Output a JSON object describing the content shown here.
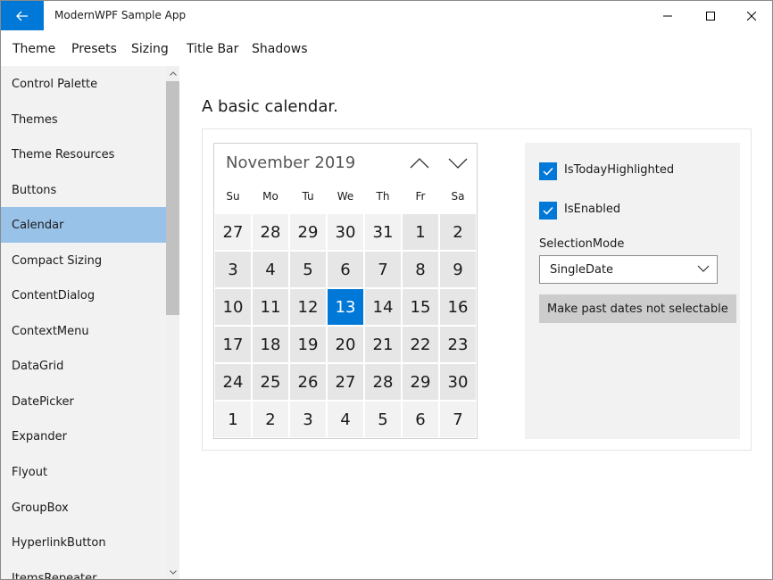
{
  "window": {
    "title": "ModernWPF Sample App"
  },
  "menu": [
    "Theme",
    "Presets",
    "Sizing",
    "Title Bar",
    "Shadows"
  ],
  "sidebar": {
    "items": [
      {
        "label": "Control Palette"
      },
      {
        "label": "Themes"
      },
      {
        "label": "Theme Resources"
      },
      {
        "label": "Buttons"
      },
      {
        "label": "Calendar",
        "selected": true
      },
      {
        "label": "Compact Sizing"
      },
      {
        "label": "ContentDialog"
      },
      {
        "label": "ContextMenu"
      },
      {
        "label": "DataGrid"
      },
      {
        "label": "DatePicker"
      },
      {
        "label": "Expander"
      },
      {
        "label": "Flyout"
      },
      {
        "label": "GroupBox"
      },
      {
        "label": "HyperlinkButton"
      },
      {
        "label": "ItemsRepeater"
      }
    ]
  },
  "page": {
    "title": "A basic calendar."
  },
  "calendar": {
    "header": "November 2019",
    "days_of_week": [
      "Su",
      "Mo",
      "Tu",
      "We",
      "Th",
      "Fr",
      "Sa"
    ],
    "weeks": [
      [
        "27",
        "28",
        "29",
        "30",
        "31",
        "1",
        "2"
      ],
      [
        "3",
        "4",
        "5",
        "6",
        "7",
        "8",
        "9"
      ],
      [
        "10",
        "11",
        "12",
        "13",
        "14",
        "15",
        "16"
      ],
      [
        "17",
        "18",
        "19",
        "20",
        "21",
        "22",
        "23"
      ],
      [
        "24",
        "25",
        "26",
        "27",
        "28",
        "29",
        "30"
      ],
      [
        "1",
        "2",
        "3",
        "4",
        "5",
        "6",
        "7"
      ]
    ],
    "today": "13"
  },
  "options": {
    "is_today_highlighted_label": "IsTodayHighlighted",
    "is_today_highlighted_checked": true,
    "is_enabled_label": "IsEnabled",
    "is_enabled_checked": true,
    "selection_mode_label": "SelectionMode",
    "selection_mode_value": "SingleDate",
    "button_label": "Make past dates not selectable"
  },
  "colors": {
    "accent": "#0078d7",
    "selected_nav": "#99c2e9",
    "sidebar_bg": "#f2f2f2"
  }
}
